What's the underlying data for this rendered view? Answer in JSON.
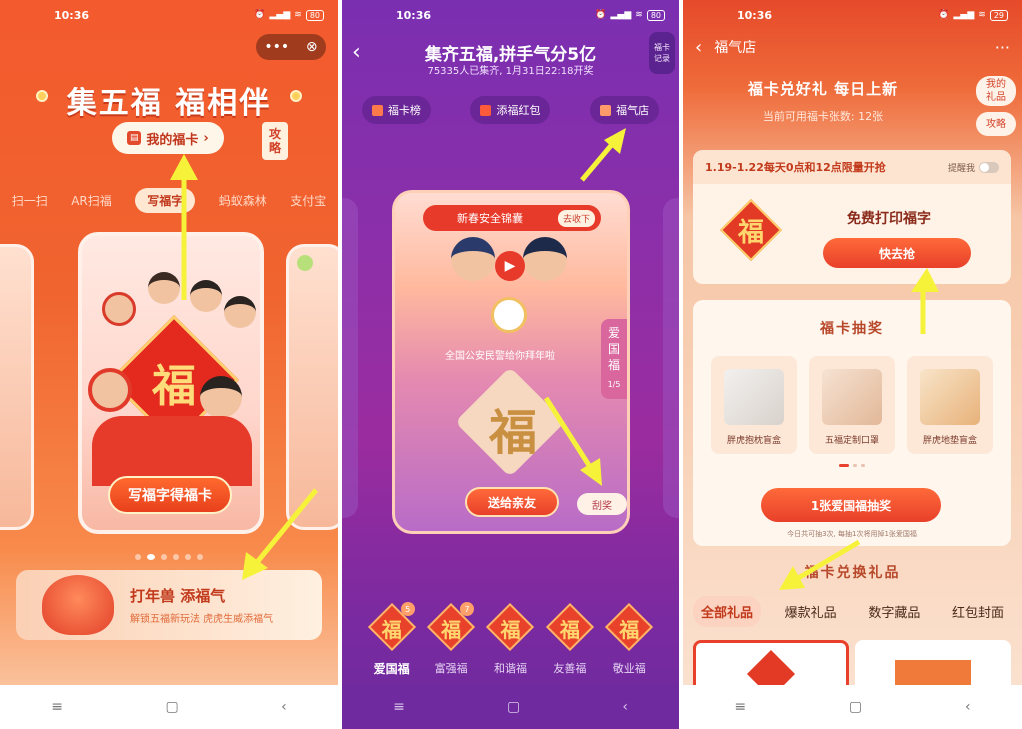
{
  "panel1": {
    "status": {
      "time": "10:36",
      "battery": "80"
    },
    "capsule": {
      "more_icon": "more-dots-icon",
      "close_icon": "close-circle-icon"
    },
    "title": "集五福 福相伴",
    "my_fu_button": "我的福卡",
    "guide_top": "攻",
    "guide_bottom": "略",
    "tabs": [
      "扫一扫",
      "AR扫福",
      "写福字",
      "蚂蚁森林",
      "支付宝"
    ],
    "active_tab_index": 2,
    "card_button": "写福字得福卡",
    "pager_count": 6,
    "pager_active": 1,
    "banner": {
      "title": "打年兽 添福气",
      "subtitle": "解锁五福新玩法 虎虎生威添福气"
    }
  },
  "panel2": {
    "status": {
      "time": "10:36",
      "battery": "80"
    },
    "title": "集齐五福,拼手气分5亿",
    "subtitle": "75335人已集齐, 1月31日22:18开奖",
    "record_top": "福卡",
    "record_bottom": "记录",
    "pills": [
      "福卡榜",
      "添福红包",
      "福气店"
    ],
    "card": {
      "header": "新春安全锦囊",
      "collapse": "去收下",
      "caption": "全国公安民警给你拜年啦",
      "side_chars": [
        "爱",
        "国",
        "福"
      ],
      "side_page": "1/5",
      "fu_char": "福",
      "send_button": "送给亲友",
      "scratch_button": "刮奖"
    },
    "fu_cards": [
      {
        "name": "爱国福",
        "count": "5",
        "char": "福"
      },
      {
        "name": "富强福",
        "count": "7",
        "char": "福"
      },
      {
        "name": "和谐福",
        "count": "",
        "char": "福"
      },
      {
        "name": "友善福",
        "count": "",
        "char": "福"
      },
      {
        "name": "敬业福",
        "count": "",
        "char": "福"
      }
    ]
  },
  "panel3": {
    "status": {
      "time": "10:36",
      "battery": "29"
    },
    "header_title": "福气店",
    "header_more": "···",
    "title": "福卡兑好礼 每日上新",
    "subtitle": "当前可用福卡张数: 12张",
    "my_gifts_top": "我的",
    "my_gifts_bottom": "礼品",
    "guide": "攻略",
    "flash": {
      "text": "1.19-1.22每天0点和12点限量开抢",
      "remind": "提醒我"
    },
    "print": {
      "title": "免费打印福字",
      "button": "快去抢",
      "char": "福"
    },
    "lottery": {
      "title": "福卡抽奖",
      "prizes": [
        "胖虎抱枕盲盒",
        "五福定制口罩",
        "胖虎地垫盲盒"
      ],
      "button": "1张爱国福抽奖",
      "note": "今日共可抽3次, 每抽1次将用掉1张爱国福"
    },
    "exchange_title": "福卡兑换礼品",
    "gift_tabs": [
      "全部礼品",
      "爆款礼品",
      "数字藏品",
      "红包封面"
    ]
  },
  "navbar": {
    "menu_icon": "≡",
    "home_icon": "▢",
    "back_icon": "‹"
  },
  "colors": {
    "arrow": "#f6f23a",
    "accent": "#e8402a",
    "gold": "#ffd66e"
  }
}
